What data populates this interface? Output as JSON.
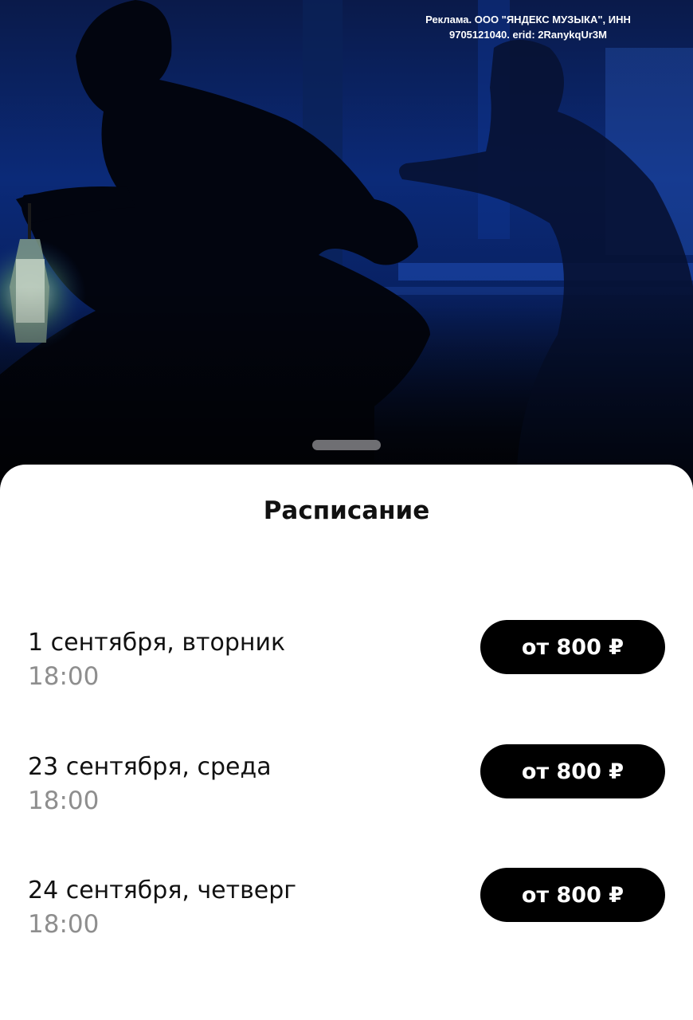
{
  "ad": {
    "line1": "Реклама. ООО \"ЯНДЕКС МУЗЫКА\", ИНН",
    "line2": "9705121040. erid: 2RanykqUr3M"
  },
  "sheet": {
    "title": "Расписание"
  },
  "sessions": [
    {
      "date": "1 сентября, вторник",
      "time": "18:00",
      "price": "от 800 ₽"
    },
    {
      "date": "23 сентября, среда",
      "time": "18:00",
      "price": "от 800 ₽"
    },
    {
      "date": "24 сентября, четверг",
      "time": "18:00",
      "price": "от 800 ₽"
    }
  ],
  "colors": {
    "hero_blue": "#0b2a78",
    "button_bg": "#000000",
    "time_gray": "#8e8e8e"
  }
}
